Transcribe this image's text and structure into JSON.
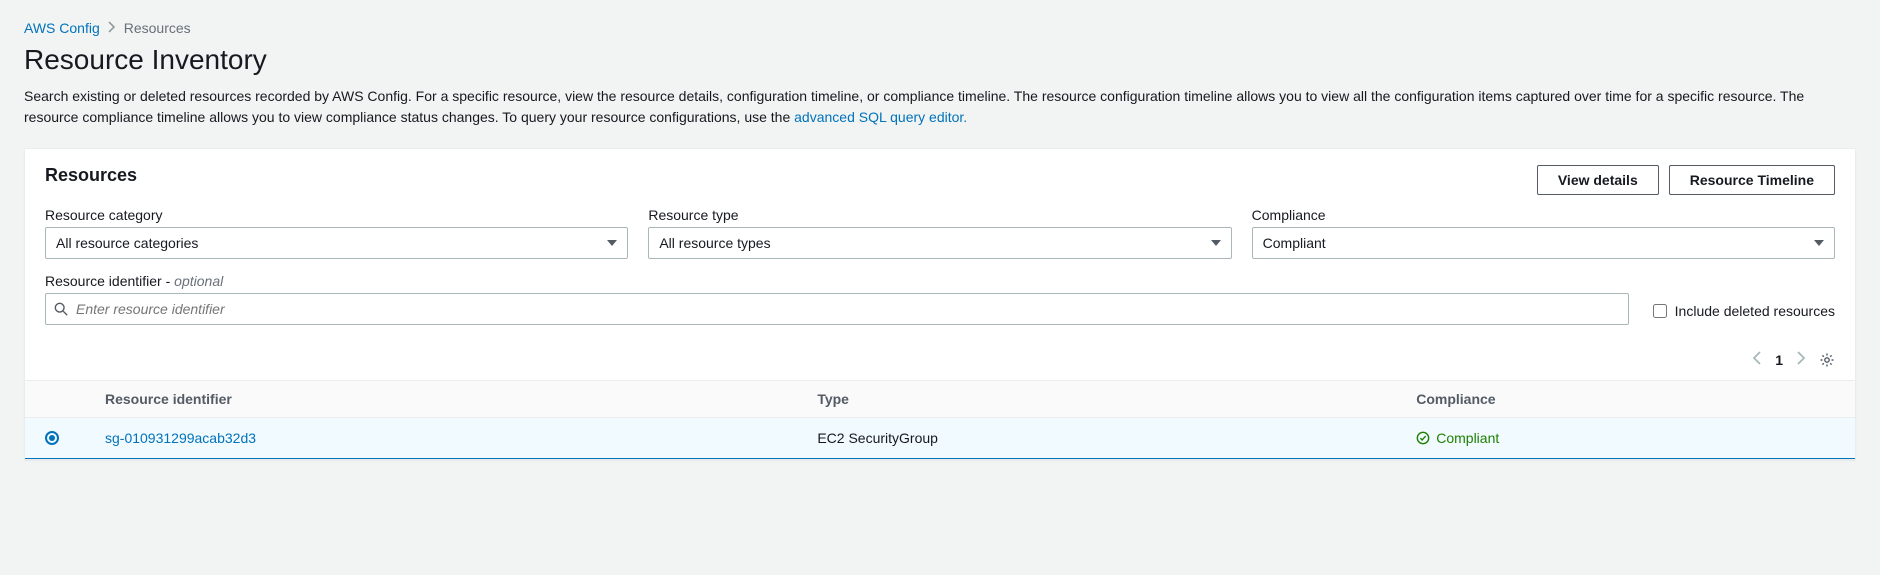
{
  "breadcrumb": {
    "root": "AWS Config",
    "current": "Resources"
  },
  "page": {
    "title": "Resource Inventory",
    "description_prefix": "Search existing or deleted resources recorded by AWS Config. For a specific resource, view the resource details, configuration timeline, or compliance timeline. The resource configuration timeline allows you to view all the configuration items captured over time for a specific resource. The resource compliance timeline allows you to view compliance status changes. To query your resource configurations, use the ",
    "description_link": "advanced SQL query editor."
  },
  "panel": {
    "title": "Resources",
    "actions": {
      "view_details": "View details",
      "resource_timeline": "Resource Timeline"
    },
    "filters": {
      "category_label": "Resource category",
      "category_value": "All resource categories",
      "type_label": "Resource type",
      "type_value": "All resource types",
      "compliance_label": "Compliance",
      "compliance_value": "Compliant",
      "identifier_label": "Resource identifier - ",
      "identifier_optional": "optional",
      "identifier_placeholder": "Enter resource identifier",
      "include_deleted": "Include deleted resources"
    },
    "pagination": {
      "page": "1"
    },
    "table": {
      "headers": {
        "identifier": "Resource identifier",
        "type": "Type",
        "compliance": "Compliance"
      },
      "row": {
        "identifier": "sg-010931299acab32d3",
        "type": "EC2 SecurityGroup",
        "compliance": "Compliant"
      }
    }
  }
}
